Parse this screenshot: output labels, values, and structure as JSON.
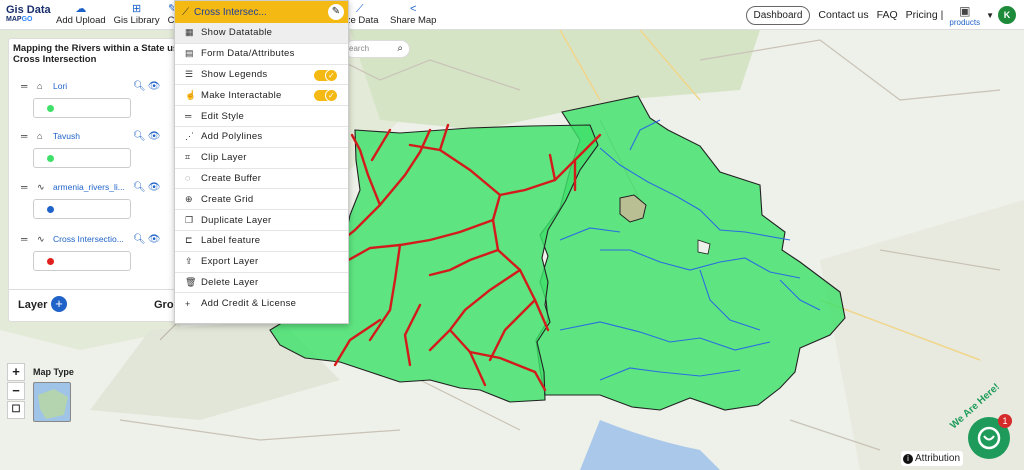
{
  "app": {
    "logo_top": "Gis Data",
    "logo_bottom_a": "MAP",
    "logo_bottom_b": "GO"
  },
  "nav": [
    {
      "label": "Add Upload",
      "icon": "cloud-upload-icon"
    },
    {
      "label": "Gis Library",
      "icon": "library-icon"
    },
    {
      "label": "Cr",
      "icon": "create-icon"
    },
    {
      "label": "yze Data",
      "icon": "analyze-icon"
    },
    {
      "label": "Share Map",
      "icon": "share-icon"
    }
  ],
  "header_right": {
    "dashboard": "Dashboard",
    "contact": "Contact us",
    "faq": "FAQ",
    "pricing": "Pricing |",
    "products": "products",
    "avatar": "K"
  },
  "panel": {
    "title_line1": "Mapping the Rivers within a State usi",
    "title_line2": "Cross Intersection",
    "layers": [
      {
        "name": "Lori",
        "type": "polygon",
        "color": "#3ee06a"
      },
      {
        "name": "Tavush",
        "type": "polygon",
        "color": "#3ee06a"
      },
      {
        "name": "armenia_rivers_li...",
        "type": "line",
        "color": "#1f63c9"
      },
      {
        "name": "Cross Intersectio...",
        "type": "line",
        "color": "#e0201e"
      }
    ],
    "footer_layer": "Layer",
    "footer_group": "Grou"
  },
  "menu": {
    "header": "Cross Intersec...",
    "items": [
      {
        "label": "Show Datatable",
        "icon": "table-icon"
      },
      {
        "label": "Form Data/Attributes",
        "icon": "form-icon"
      },
      {
        "label": "Show Legends",
        "icon": "list-icon",
        "toggle": true
      },
      {
        "label": "Make Interactable",
        "icon": "hand-icon",
        "toggle": true
      },
      {
        "label": "Edit Style",
        "icon": "edit-icon"
      },
      {
        "label": "Add Polylines",
        "icon": "polyline-icon"
      },
      {
        "label": "Clip Layer",
        "icon": "crop-icon"
      },
      {
        "label": "Create Buffer",
        "icon": "buffer-icon"
      },
      {
        "label": "Create Grid",
        "icon": "grid-icon"
      },
      {
        "label": "Duplicate Layer",
        "icon": "duplicate-icon"
      },
      {
        "label": "Label feature",
        "icon": "label-icon"
      },
      {
        "label": "Export Layer",
        "icon": "export-icon"
      },
      {
        "label": "Delete Layer",
        "icon": "trash-icon"
      },
      {
        "label": "Add Credit & License",
        "icon": "plus-icon"
      }
    ]
  },
  "search": {
    "placeholder": "earch"
  },
  "map_controls": {
    "zoom_in": "+",
    "zoom_out": "−",
    "map_type": "Map Type"
  },
  "attribution": "Attribution",
  "chat": {
    "badge": "1",
    "tagline": "We Are Here!"
  },
  "colors": {
    "accent": "#f4b913",
    "polygon": "#3ee06a",
    "river": "#1f63c9",
    "intersection": "#d41b1b"
  }
}
